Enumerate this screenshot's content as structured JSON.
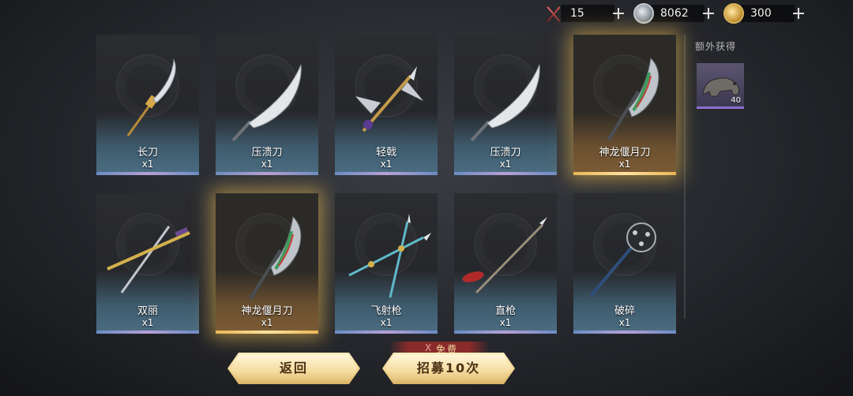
{
  "currency": [
    {
      "icon": "crossed-swords-icon",
      "value": "15"
    },
    {
      "icon": "silver-ingot-icon",
      "value": "8062"
    },
    {
      "icon": "gold-ingot-icon",
      "value": "300"
    }
  ],
  "cards": [
    {
      "name": "长刀",
      "qty": "x1",
      "rarity": "blue",
      "icon": "long-blade-icon"
    },
    {
      "name": "压溃刀",
      "qty": "x1",
      "rarity": "blue",
      "icon": "crushing-saber-icon"
    },
    {
      "name": "轻戟",
      "qty": "x1",
      "rarity": "blue",
      "icon": "light-halberd-icon"
    },
    {
      "name": "压溃刀",
      "qty": "x1",
      "rarity": "blue",
      "icon": "crushing-saber-icon"
    },
    {
      "name": "神龙偃月刀",
      "qty": "x1",
      "rarity": "gold",
      "icon": "dragon-crescent-blade-icon"
    },
    {
      "name": "双丽",
      "qty": "x1",
      "rarity": "blue",
      "icon": "twin-swords-icon"
    },
    {
      "name": "神龙偃月刀",
      "qty": "x1",
      "rarity": "gold",
      "icon": "dragon-crescent-blade-icon"
    },
    {
      "name": "飞射枪",
      "qty": "x1",
      "rarity": "blue",
      "icon": "twin-spears-icon"
    },
    {
      "name": "直枪",
      "qty": "x1",
      "rarity": "blue",
      "icon": "straight-spear-icon"
    },
    {
      "name": "破碎",
      "qty": "x1",
      "rarity": "blue",
      "icon": "spiked-mace-icon"
    }
  ],
  "side": {
    "title": "额外获得",
    "item_count": "40",
    "item_icon": "beast-figurine-icon"
  },
  "buttons": {
    "back_label": "返回",
    "recruit_label": "招募10次",
    "free_x": "X",
    "free_label": "免费"
  },
  "colors": {
    "gold_glow": "#f0be50",
    "button_text": "#4a2e12",
    "blue_card_bottom": "#4c6e83",
    "gold_card_bottom": "#7d5c35"
  }
}
